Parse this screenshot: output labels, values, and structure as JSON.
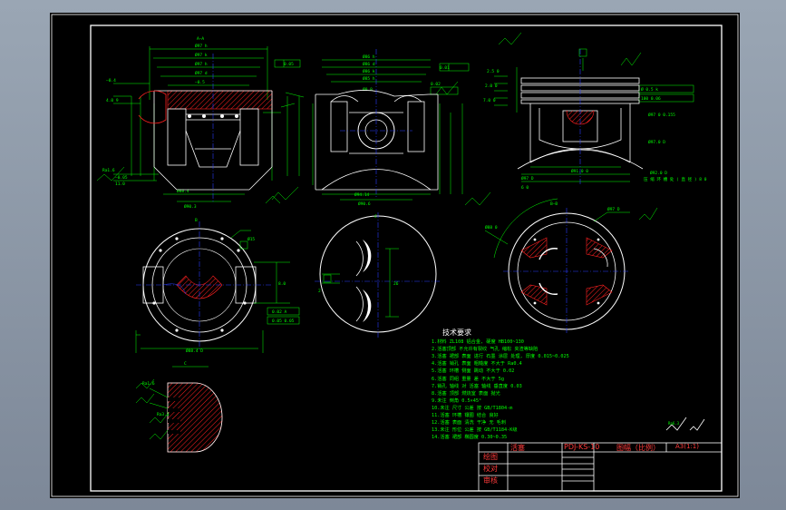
{
  "title_block": {
    "drawing_no": "PDJ-KS-10",
    "part_name": "活塞",
    "scale_label": "图幅（比例）",
    "scale_value": "A3(1:1)",
    "rows": [
      "绘图",
      "校对",
      "审核"
    ]
  },
  "technical_notes": {
    "heading": "技术要求",
    "items": [
      "1.材料 ZL108 铝合金, 硬度 HB100~130",
      "2.活塞顶部 不允许有裂纹 气孔 缩松 夹渣等缺陷",
      "3.活塞 裙部 表面 进行 石墨 涂层 处理, 厚度 0.015~0.025",
      "4.活塞 销孔 表面 粗糙度 不大于 Ra0.4",
      "5.活塞 环槽 侧面 跳动 不大于 0.02",
      "6.活塞 同组 重量 差 不大于 5g",
      "7.销孔 轴线 对 活塞 轴线 垂直度 0.03",
      "8.活塞 顶部 燃烧室 表面 抛光",
      "9.未注 倒角 0.5×45°",
      "10.未注 尺寸 公差 按 GB/T1804-m",
      "11.活塞 环槽 镶圈 结合 良好",
      "12.活塞 表面 清洗 干净 无 毛刺",
      "13.未注 形位 公差 按 GB/T1184-K级",
      "14.活塞 裙部 椭圆度 0.30~0.35"
    ]
  },
  "colors": {
    "sheet": "#000000",
    "frame": "#ffffff",
    "outline": "#ffffff",
    "dimension": "#00ff00",
    "centerline": "#2a3dff",
    "section_hatch": "#ff2020",
    "notes_heading": "#ffffff",
    "title_text": "#ff3b3b"
  },
  "icons": [
    "surface-roughness-symbol",
    "datum-feature-symbol",
    "section-hatch"
  ]
}
